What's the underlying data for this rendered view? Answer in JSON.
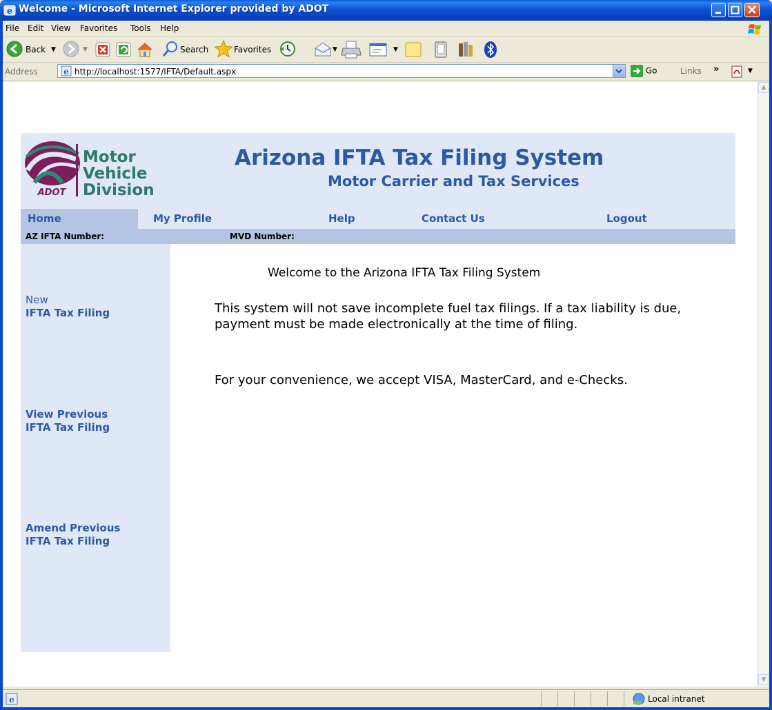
{
  "window": {
    "title": "Welcome - Microsoft Internet Explorer provided by ADOT"
  },
  "menu": {
    "items": [
      "File",
      "Edit",
      "View",
      "Favorites",
      "Tools",
      "Help"
    ]
  },
  "toolbar": {
    "back_label": "Back",
    "search_label": "Search",
    "favorites_label": "Favorites"
  },
  "address": {
    "label": "Address",
    "url": "http://localhost:1577/IFTA/Default.aspx",
    "go_label": "Go",
    "links_label": "Links"
  },
  "page": {
    "logo": {
      "line1": "Motor",
      "line2": "Vehicle",
      "line3": "Division",
      "badge": "ADOT"
    },
    "title": "Arizona IFTA Tax Filing System",
    "subtitle": "Motor Carrier and Tax Services",
    "nav": {
      "home": "Home",
      "profile": "My Profile",
      "help": "Help",
      "contact": "Contact Us",
      "logout": "Logout"
    },
    "info": {
      "ifta_label": "AZ IFTA Number:",
      "mvd_label": "MVD Number:"
    },
    "sidebar": {
      "new_line1": "New",
      "new_line2": "IFTA Tax Filing",
      "view_line1": "View Previous",
      "view_line2": "IFTA Tax Filing",
      "amend_line1": "Amend Previous",
      "amend_line2": "IFTA Tax Filing"
    },
    "welcome": "Welcome to the Arizona IFTA Tax Filing System",
    "para1": "This system will not save incomplete fuel tax filings. If a tax liability is due, payment must be made electronically at the time of filing.",
    "para2": "For your convenience, we accept VISA, MasterCard, and e-Checks."
  },
  "status": {
    "zone": "Local intranet"
  }
}
